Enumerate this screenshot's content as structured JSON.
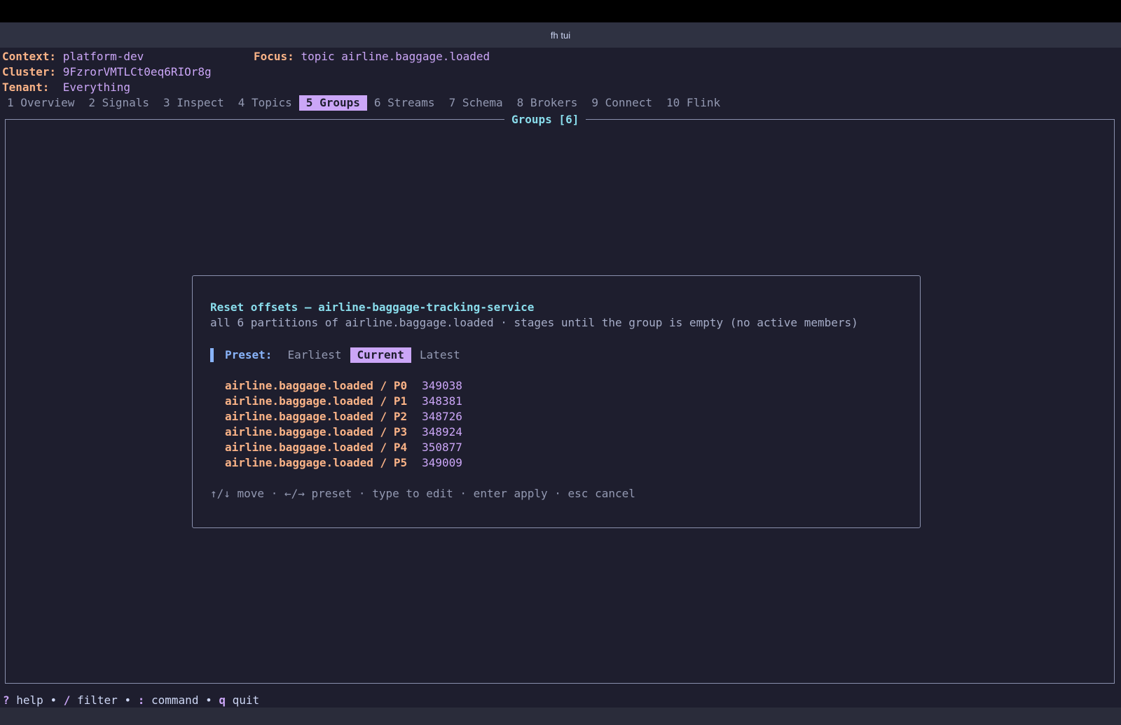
{
  "window": {
    "title": "fh tui"
  },
  "header": {
    "context_label": "Context:",
    "context_value": "platform-dev",
    "focus_label": "Focus:",
    "focus_value": "topic airline.baggage.loaded",
    "cluster_label": "Cluster:",
    "cluster_value": "9FzrorVMTLCt0eq6RIOr8g",
    "tenant_label": "Tenant:",
    "tenant_value": "Everything"
  },
  "tabs": [
    {
      "label": "1 Overview",
      "active": false
    },
    {
      "label": "2 Signals",
      "active": false
    },
    {
      "label": "3 Inspect",
      "active": false
    },
    {
      "label": "4 Topics",
      "active": false
    },
    {
      "label": "5 Groups",
      "active": true
    },
    {
      "label": "6 Streams",
      "active": false
    },
    {
      "label": "7 Schema",
      "active": false
    },
    {
      "label": "8 Brokers",
      "active": false
    },
    {
      "label": "9 Connect",
      "active": false
    },
    {
      "label": "10 Flink",
      "active": false
    }
  ],
  "pane": {
    "title": "Groups [6]"
  },
  "dialog": {
    "title": "Reset offsets — airline-baggage-tracking-service",
    "subtitle": "all 6 partitions of airline.baggage.loaded · stages until the group is empty (no active members)",
    "preset_label": "Preset:",
    "presets": [
      {
        "label": "Earliest",
        "active": false
      },
      {
        "label": "Current",
        "active": true
      },
      {
        "label": "Latest",
        "active": false
      }
    ],
    "partitions": [
      {
        "name": "airline.baggage.loaded / P0",
        "offset": "349038"
      },
      {
        "name": "airline.baggage.loaded / P1",
        "offset": "348381"
      },
      {
        "name": "airline.baggage.loaded / P2",
        "offset": "348726"
      },
      {
        "name": "airline.baggage.loaded / P3",
        "offset": "348924"
      },
      {
        "name": "airline.baggage.loaded / P4",
        "offset": "350877"
      },
      {
        "name": "airline.baggage.loaded / P5",
        "offset": "349009"
      }
    ],
    "hint": "↑/↓ move · ←/→ preset · type to edit · enter apply · esc cancel"
  },
  "statusbar": {
    "help_key": "?",
    "help_label": "help",
    "filter_key": "/",
    "filter_label": "filter",
    "command_key": ":",
    "command_label": "command",
    "quit_key": "q",
    "quit_label": "quit",
    "separator": "•"
  },
  "colors": {
    "background": "#1e1e2e",
    "accent": "#cba6f7",
    "label": "#fab387",
    "title": "#89dceb",
    "focus": "#89b4fa"
  }
}
